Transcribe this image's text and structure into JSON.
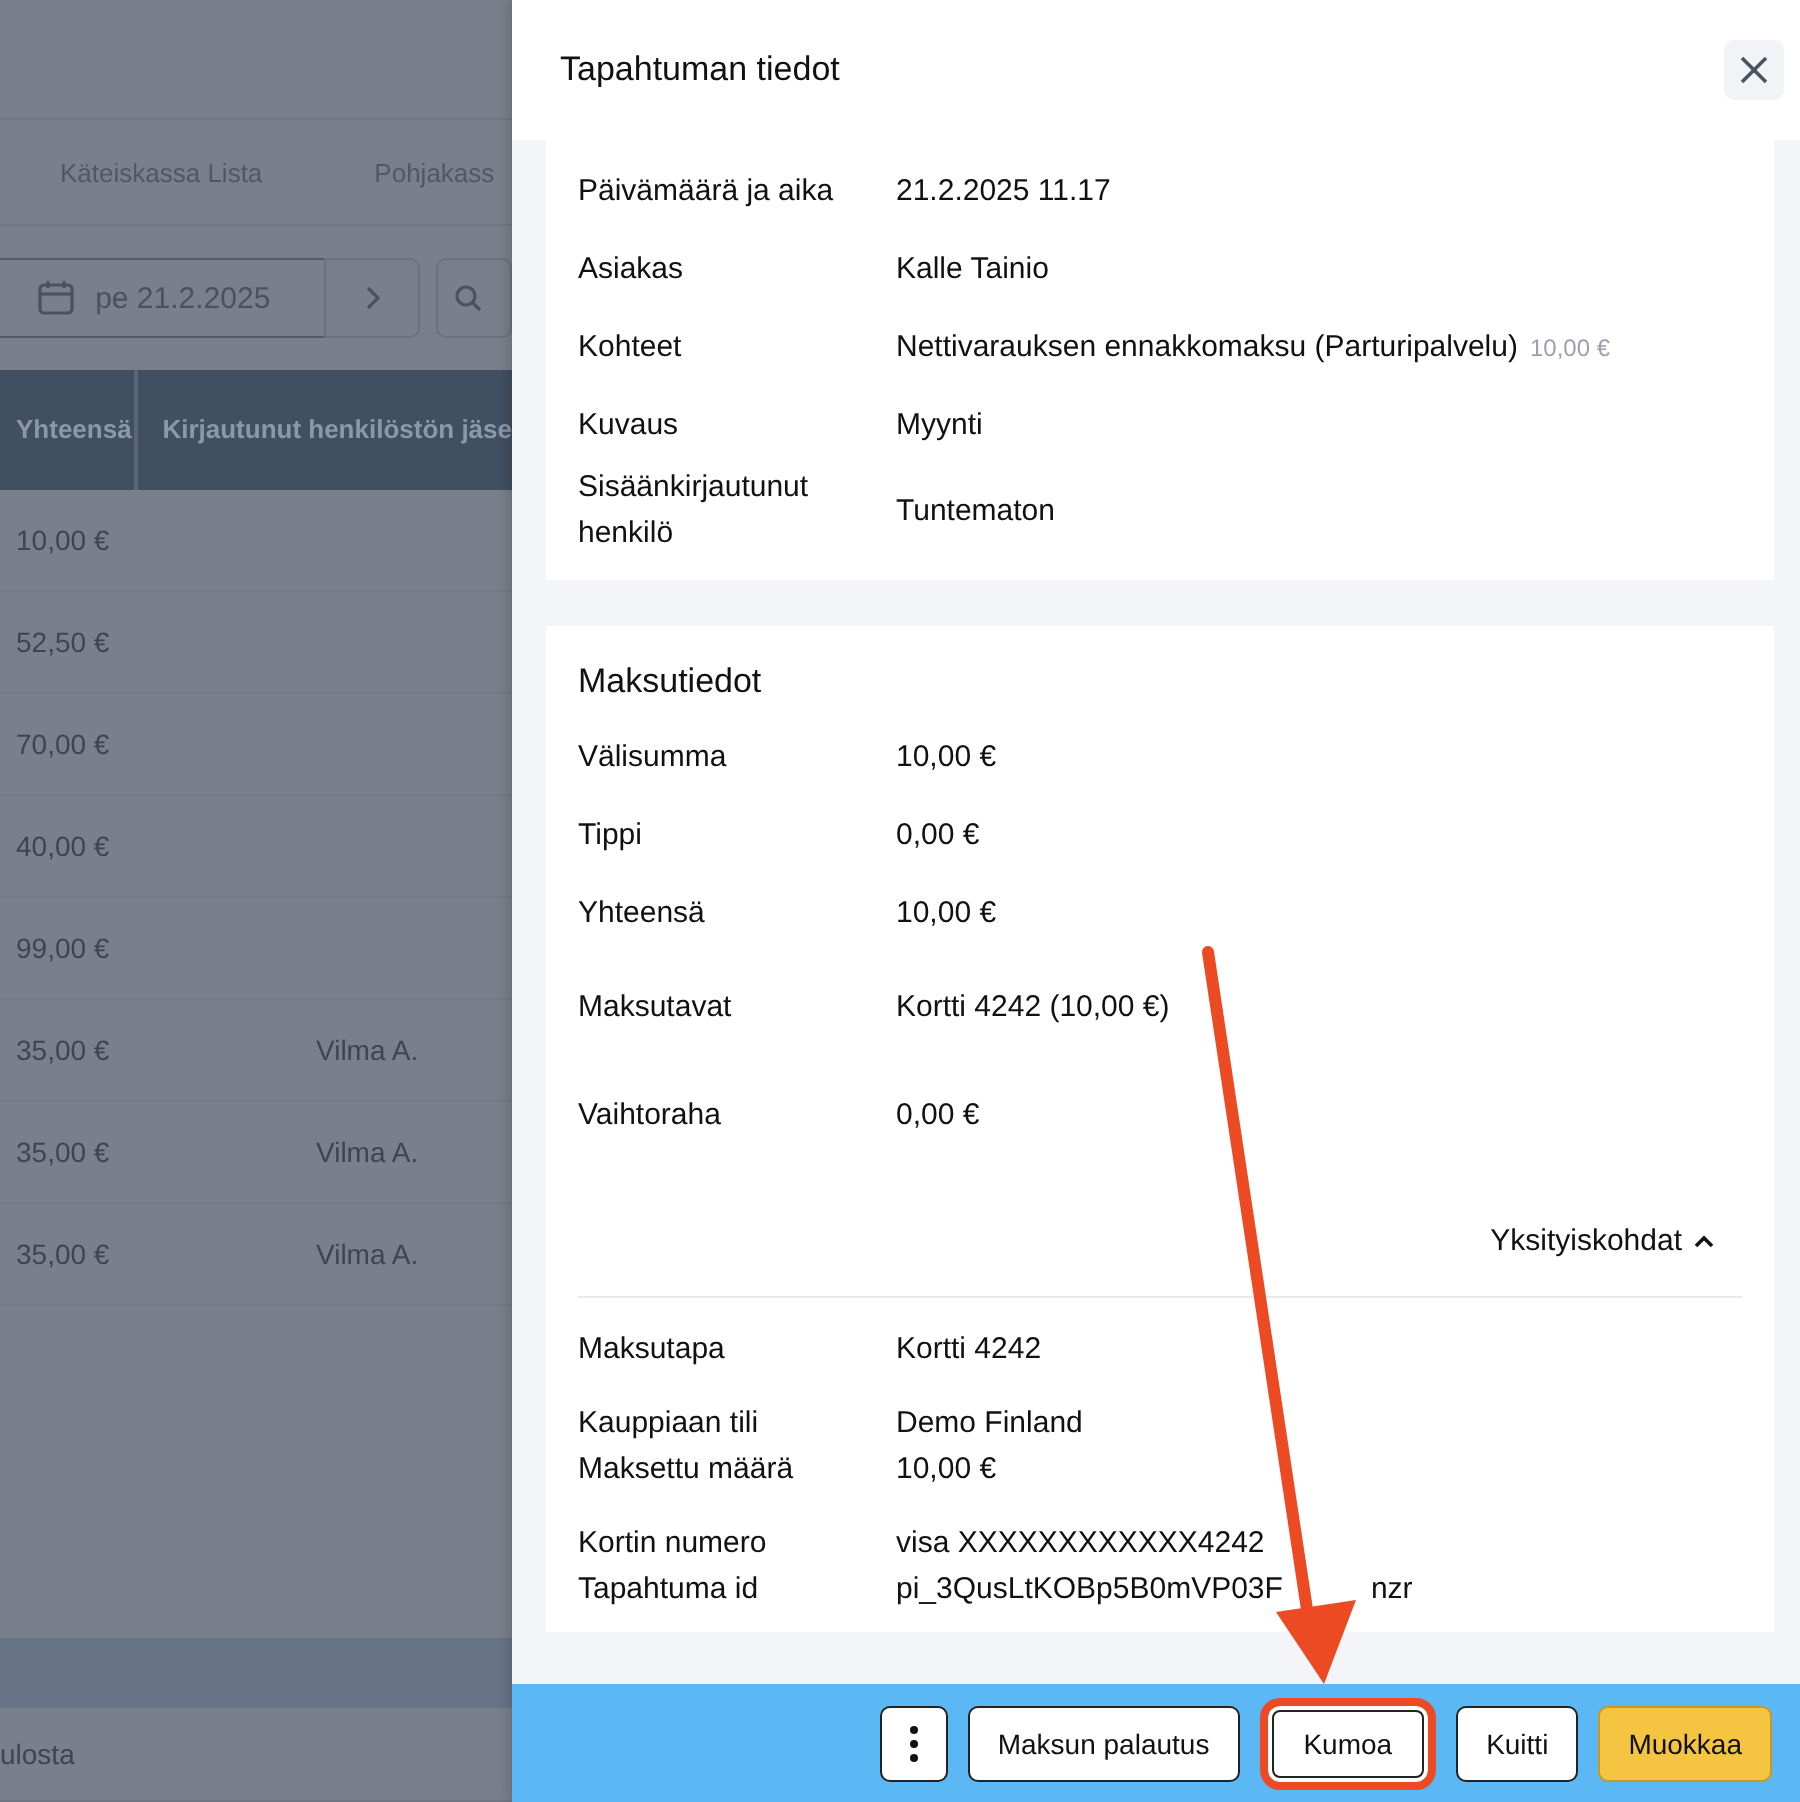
{
  "background_page": {
    "tabs": [
      {
        "label": "Käteiskassa Lista"
      },
      {
        "label": "Pohjakass"
      }
    ],
    "date_picker": {
      "value": "pe 21.2.2025"
    },
    "table": {
      "columns": [
        "Yhteensä",
        "Kirjautunut henkilöstön jäse"
      ],
      "rows": [
        {
          "total": "10,00 €"
        },
        {
          "total": "52,50 €"
        },
        {
          "total": "70,00 €"
        },
        {
          "total": "40,00 €"
        },
        {
          "total": "99,00 €"
        },
        {
          "total": "35,00 €",
          "staff": "Vilma A."
        },
        {
          "total": "35,00 €",
          "staff": "Vilma A."
        },
        {
          "total": "35,00 €",
          "staff": "Vilma A."
        }
      ]
    },
    "footer_text": "ulosta"
  },
  "panel": {
    "title": "Tapahtuman tiedot",
    "details": [
      {
        "label": "Päivämäärä ja aika",
        "value": "21.2.2025 11.17"
      },
      {
        "label": "Asiakas",
        "value": "Kalle Tainio"
      },
      {
        "label": "Kohteet",
        "value": "Nettivarauksen ennakkomaksu (Parturipalvelu)",
        "price": "10,00 €"
      },
      {
        "label": "Kuvaus",
        "value": "Myynti"
      },
      {
        "label": "Sisäänkirjautunut henkilö",
        "value": "Tuntematon"
      }
    ],
    "payment": {
      "title": "Maksutiedot",
      "rows": [
        {
          "label": "Välisumma",
          "value": "10,00 €"
        },
        {
          "label": "Tippi",
          "value": "0,00 €"
        },
        {
          "label": "Yhteensä",
          "value": "10,00 €"
        },
        {
          "label": "Maksutavat",
          "value": "Kortti 4242 (10,00 €)"
        },
        {
          "label": "Vaihtoraha",
          "value": "0,00 €"
        }
      ],
      "details_toggle": {
        "label": "Yksityiskohdat",
        "expanded": true
      },
      "detail_groups": [
        [
          {
            "label": "Maksutapa",
            "value": "Kortti 4242"
          }
        ],
        [
          {
            "label": "Kauppiaan tili",
            "value": "Demo Finland"
          },
          {
            "label": "Maksettu määrä",
            "value": "10,00 €"
          }
        ],
        [
          {
            "label": "Kortin numero",
            "value": "visa XXXXXXXXXXXX4242"
          },
          {
            "label": "Tapahtuma id",
            "value": "pi_3QusLtKOBp5B0mVP03F",
            "value_end": "nzr"
          }
        ]
      ]
    }
  },
  "actions": [
    {
      "kind": "menu",
      "highlighted": false
    },
    {
      "kind": "button",
      "label": "Maksun palautus",
      "highlighted": false
    },
    {
      "kind": "button",
      "label": "Kumoa",
      "highlighted": true
    },
    {
      "kind": "button",
      "label": "Kuitti",
      "highlighted": false
    },
    {
      "kind": "primary",
      "label": "Muokkaa",
      "highlighted": false
    }
  ]
}
